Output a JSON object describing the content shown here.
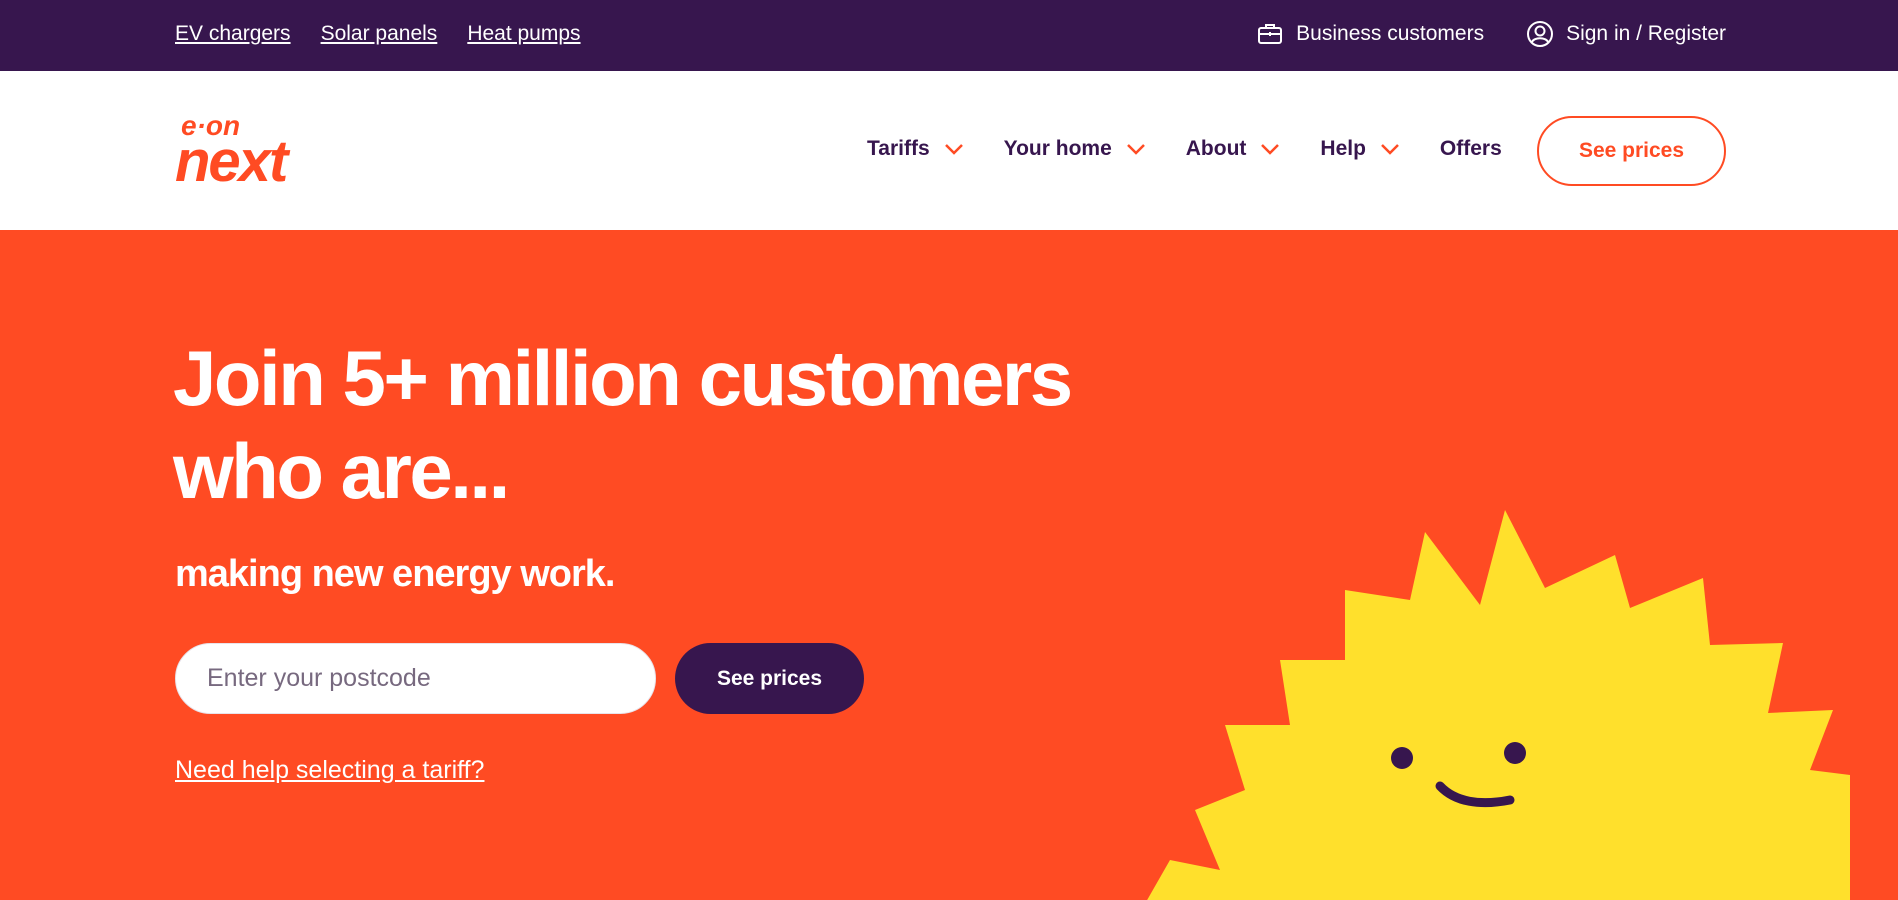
{
  "topbar": {
    "links": [
      "EV chargers",
      "Solar panels",
      "Heat pumps"
    ],
    "business_label": "Business customers",
    "signin_label": "Sign in / Register"
  },
  "header": {
    "logo_text_top": "e·on",
    "logo_text_bottom": "next",
    "nav": [
      "Tariffs",
      "Your home",
      "About",
      "Help",
      "Offers"
    ],
    "cta_label": "See prices"
  },
  "hero": {
    "headline_line1": "Join 5+ million customers",
    "headline_line2": "who are...",
    "subheading": "making new energy work.",
    "postcode_placeholder": "Enter your postcode",
    "cta_label": "See prices",
    "help_link": "Need help selecting a tariff?"
  },
  "colors": {
    "brand_orange": "#ff4b23",
    "brand_purple": "#37164e",
    "sun_yellow": "#ffe02c"
  },
  "icons": {
    "business": "briefcase-icon",
    "signin": "user-circle-icon",
    "nav_dropdown": "chevron-down-icon"
  }
}
